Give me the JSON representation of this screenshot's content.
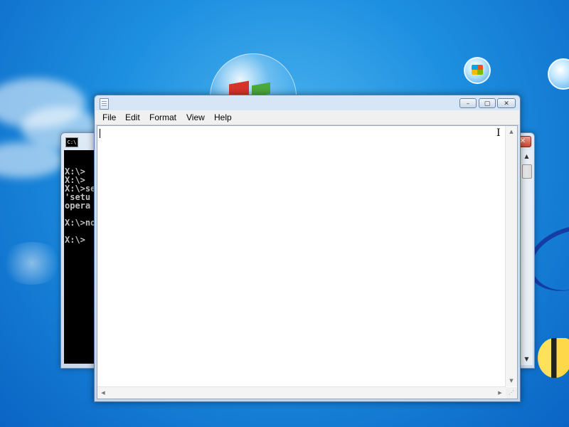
{
  "desktop": {
    "background_color": "#1d8fe0"
  },
  "cmd_window": {
    "icon_label": "C:\\",
    "close_label": "✕",
    "console_lines": [
      "",
      "X:\\>",
      "X:\\>",
      "X:\\>se",
      "'setu",
      "opera",
      "",
      "X:\\>no",
      "",
      "X:\\>"
    ],
    "scroll_up_icon": "▲",
    "scroll_down_icon": "▼"
  },
  "notepad": {
    "title": "",
    "min_label": "–",
    "max_label": "▢",
    "close_label": "✕",
    "menu": [
      {
        "label": "File"
      },
      {
        "label": "Edit"
      },
      {
        "label": "Format"
      },
      {
        "label": "View"
      },
      {
        "label": "Help"
      }
    ],
    "editor_text": "",
    "cursor_glyph": "I",
    "scroll_up_icon": "▲",
    "scroll_down_icon": "▼",
    "scroll_left_icon": "◀",
    "scroll_right_icon": "▶",
    "grip_glyph": "⋰"
  }
}
